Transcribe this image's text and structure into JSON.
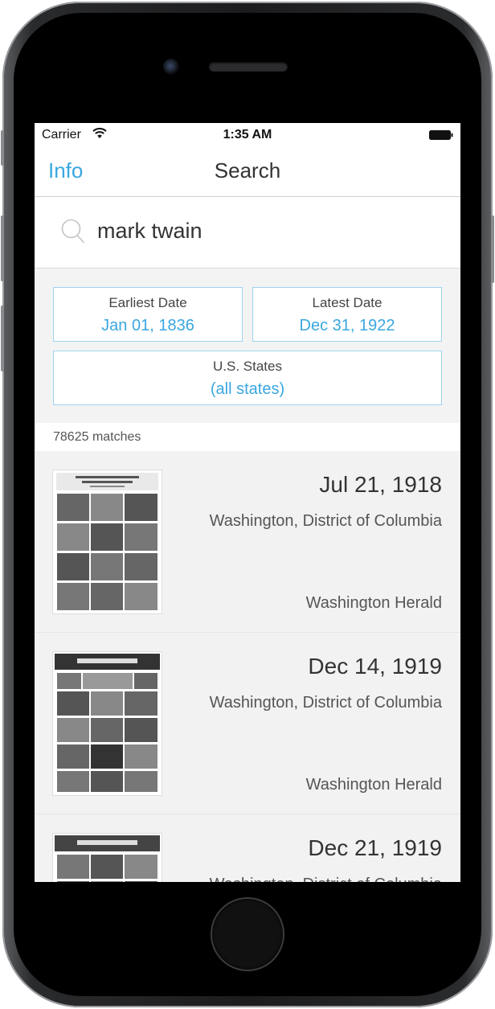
{
  "status_bar": {
    "carrier": "Carrier",
    "time": "1:35 AM"
  },
  "nav": {
    "info_label": "Info",
    "title": "Search"
  },
  "search": {
    "value": "mark twain"
  },
  "filters": {
    "earliest_label": "Earliest Date",
    "earliest_value": "Jan 01, 1836",
    "latest_label": "Latest Date",
    "latest_value": "Dec 31, 1922",
    "states_label": "U.S. States",
    "states_value": "(all states)"
  },
  "matches_text": "78625 matches",
  "results": [
    {
      "date": "Jul 21, 1918",
      "place": "Washington, District of Columbia",
      "paper": "Washington Herald"
    },
    {
      "date": "Dec 14, 1919",
      "place": "Washington, District of Columbia",
      "paper": "Washington Herald"
    },
    {
      "date": "Dec 21, 1919",
      "place": "Washington, District of Columbia",
      "paper": ""
    }
  ],
  "colors": {
    "accent": "#3aa7e0",
    "filter_border": "#9ed3ee",
    "background_gray": "#f2f2f2"
  },
  "icons": {
    "wifi": "wifi-icon",
    "battery": "battery-icon",
    "search": "search-icon",
    "thumbnail": "newspaper-page-thumbnail"
  }
}
